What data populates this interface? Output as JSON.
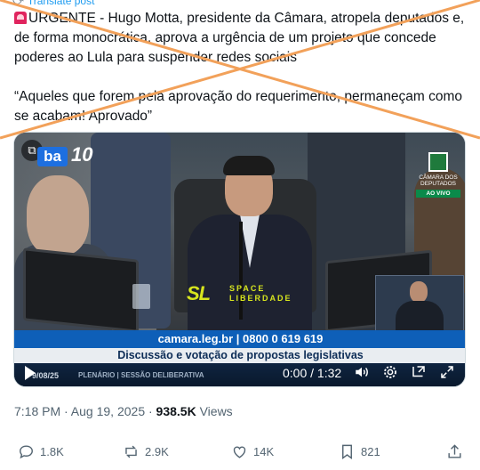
{
  "translate_label": "Translate post",
  "post": {
    "line1": "URGENTE - Hugo Motta, presidente da Câmara, atropela deputados e, de forma monocrática, aprova a urgência de um projeto que concede poderes ao Lula para suspender redes sociais",
    "quote": "“Aqueles que forem pela aprovação do requerimento, permaneçam como se acabam! Aprovado”"
  },
  "video": {
    "channel_logo": "ba",
    "channel_number": "10",
    "camara_label": "CÂMARA DOS DEPUTADOS",
    "camara_live": "AO VIVO",
    "space_logo": "SL",
    "space_line1": "SPACE",
    "space_line2": "LIBERDADE",
    "contact_bar": "camara.leg.br | 0800 0 619 619",
    "title_bar": "Discussão e votação de propostas legislativas",
    "date": "9/08/25",
    "session": "PLENÁRIO | SESSÃO DELIBERATIVA",
    "time_display": "0:00 / 1:32"
  },
  "meta": {
    "time": "7:18 PM · Aug 19, 2025 · ",
    "views_count": "938.5K",
    "views_label": " Views"
  },
  "actions": {
    "replies": "1.8K",
    "reposts": "2.9K",
    "likes": "14K",
    "bookmarks": "821"
  },
  "colors": {
    "overlay_cross": "#f2a15a",
    "link": "#1d9bf0",
    "secondary_text": "#536471",
    "camara_blue": "#0e5fb8"
  },
  "icons": [
    "translate-icon",
    "siren-icon",
    "image-badge-icon",
    "play-icon",
    "volume-icon",
    "settings-icon",
    "pip-icon",
    "fullscreen-icon",
    "reply-icon",
    "repost-icon",
    "like-icon",
    "bookmark-icon",
    "share-icon"
  ]
}
